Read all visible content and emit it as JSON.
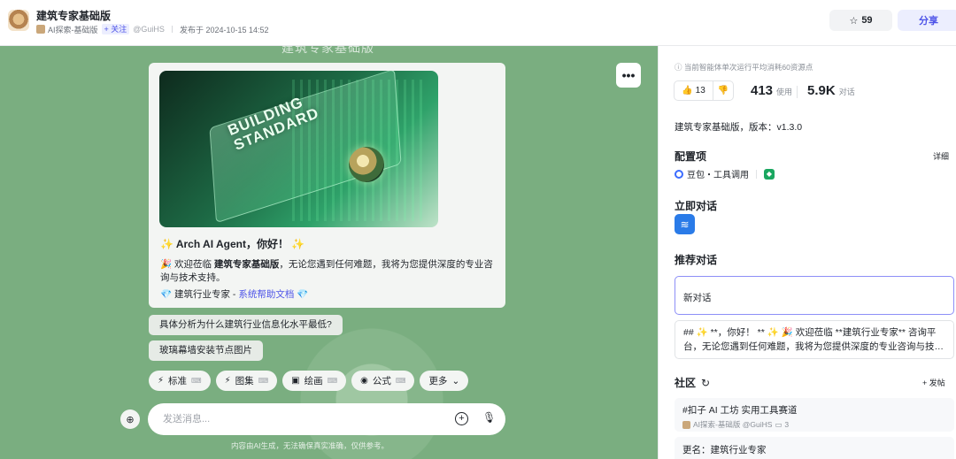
{
  "header": {
    "app_title": "建筑专家基础版",
    "workspace": "AI探索-基础版",
    "follow_label": "+ 关注",
    "handle": "@GuiHS",
    "published": "发布于 2024-10-15 14:52",
    "star_count": "59",
    "share_label": "分享"
  },
  "chat": {
    "bg_title": "建筑专家基础版",
    "hero_text_line1": "BUILDING",
    "hero_text_line2": "STANDARD",
    "greeting": "✨ Arch AI Agent，你好！ ✨",
    "welcome_prefix": "🎉 欢迎莅临 ",
    "welcome_bold": "建筑专家基础版",
    "welcome_rest": "，无论您遇到任何难题，我将为您提供深度的专业咨询与技术支持。",
    "sub_prefix": "💎 建筑行业专家 - ",
    "sub_link": "系统帮助文档",
    "sub_suffix": " 💎",
    "suggestions": [
      "具体分析为什么建筑行业信息化水平最低?",
      "玻璃幕墙安装节点图片"
    ],
    "tools": [
      {
        "label": "标准",
        "icon": "⚡"
      },
      {
        "label": "图集",
        "icon": "⚡"
      },
      {
        "label": "绘画",
        "icon": "▣"
      },
      {
        "label": "公式",
        "icon": "◉"
      }
    ],
    "more_label": "更多",
    "input_placeholder": "发送消息...",
    "disclaimer": "内容由AI生成，无法确保真实准确，仅供参考。"
  },
  "panel": {
    "cost_note": "ⓘ 当前智能体单次运行平均消耗60资源点",
    "likes": "13",
    "usage_count": "413",
    "usage_label": "使用",
    "dialog_count": "5.9K",
    "dialog_label": "对话",
    "version_text": "建筑专家基础版，版本：v1.3.0",
    "config_title": "配置项",
    "detail_label": "详细",
    "model_label": "豆包・工具调用",
    "chat_now_title": "立即对话",
    "recommend_title": "推荐对话",
    "new_conv": "新对话",
    "preview_text": "## ✨ **，你好！ ** ✨ 🎉 欢迎莅临 **建筑行业专家** 咨询平台，无论您遇到任何难题，我将为您提供深度的专业咨询与技…",
    "community_title": "社区",
    "post_label": "+ 发帖",
    "post_title": "#扣子 AI 工坊 实用工具赛道",
    "post_author": "AI探索-基础版 @GuiHS",
    "post_comments": "3",
    "post2_text": "更名：建筑行业专家"
  }
}
